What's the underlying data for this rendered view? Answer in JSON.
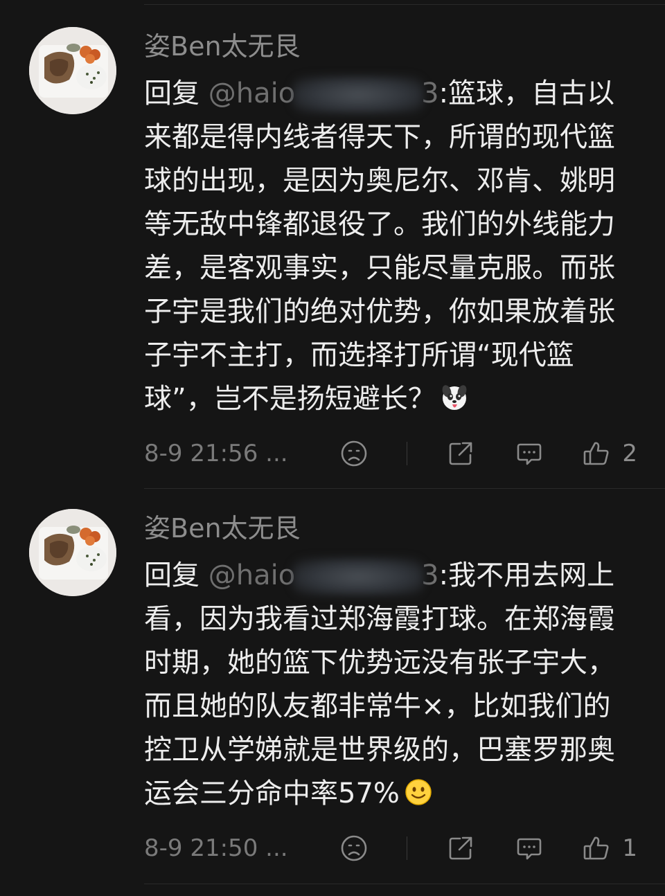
{
  "comments": [
    {
      "username": "姿Ben太无艮",
      "reply_prefix": "回复",
      "mention": "@haio",
      "mention_tail": "3",
      "text": ":篮球，自古以来都是得内线者得天下，所谓的现代篮球的出现，是因为奥尼尔、邓肯、姚明等无敌中锋都退役了。我们的外线能力差，是客观事实，只能尽量克服。而张子宇是我们的绝对优势，你如果放着张子宇不主打，而选择打所谓“现代篮球”，岂不是扬短避长？",
      "emoji": "dog-tongue-emoji",
      "timestamp": "8-9 21:56 ...",
      "like_count": "2"
    },
    {
      "username": "姿Ben太无艮",
      "reply_prefix": "回复",
      "mention": "@haio",
      "mention_tail": "3",
      "text": ":我不用去网上看，因为我看过郑海霞打球。在郑海霞时期，她的篮下优势远没有张子宇大，而且她的队友都非常牛×，比如我们的控卫从学娣就是世界级的，巴塞罗那奥运会三分命中率57%",
      "emoji": "smile-emoji",
      "timestamp": "8-9 21:50 ...",
      "like_count": "1"
    }
  ],
  "icons": {
    "dislike": "frown-face-icon",
    "share": "share-icon",
    "reply": "comment-bubble-icon",
    "like": "thumbs-up-icon"
  },
  "colors": {
    "background": "#151515",
    "text": "#ededed",
    "muted": "#8d8d8d"
  }
}
